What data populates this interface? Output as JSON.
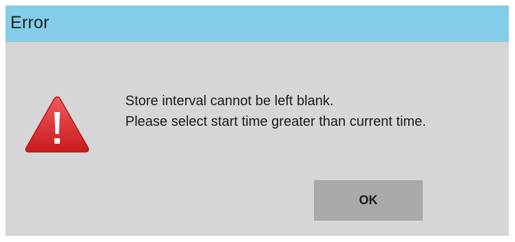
{
  "dialog": {
    "title": "Error",
    "icon": "warning-icon",
    "message_lines": [
      "Store interval cannot be left blank.",
      "Please select start time greater than current time."
    ],
    "ok_label": "OK"
  },
  "colors": {
    "titlebar": "#83cde8",
    "body": "#d6d6d6",
    "button": "#a9a9a9",
    "warning_red": "#e0262a"
  }
}
